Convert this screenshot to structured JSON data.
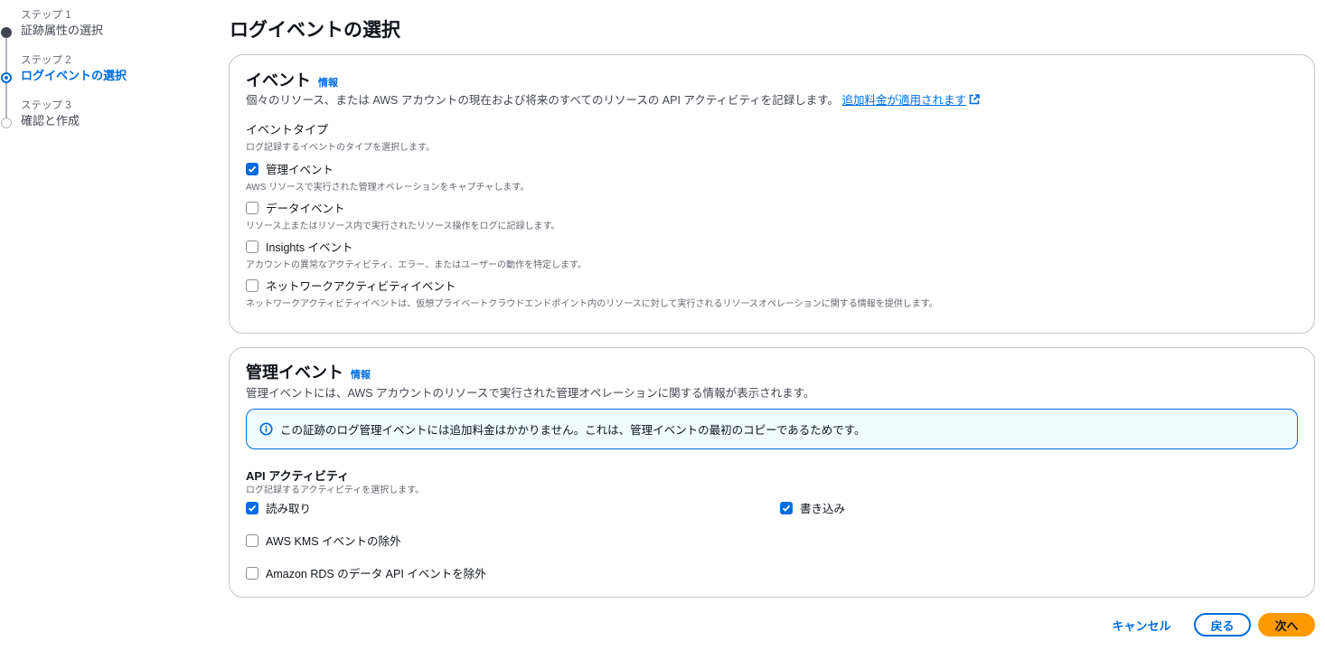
{
  "steps": [
    {
      "num": "ステップ 1",
      "title": "証跡属性の選択",
      "state": "done"
    },
    {
      "num": "ステップ 2",
      "title": "ログイベントの選択",
      "state": "active"
    },
    {
      "num": "ステップ 3",
      "title": "確認と作成",
      "state": "todo"
    }
  ],
  "page_title": "ログイベントの選択",
  "events_card": {
    "title": "イベント",
    "info": "情報",
    "description": "個々のリソース、または AWS アカウントの現在および将来のすべてのリソースの API アクティビティを記録します。",
    "link": "追加料金が適用されます",
    "event_type_label": "イベントタイプ",
    "event_type_hint": "ログ記録するイベントのタイプを選択します。",
    "options": [
      {
        "label": "管理イベント",
        "desc": "AWS リソースで実行された管理オペレーションをキャプチャします。",
        "checked": true
      },
      {
        "label": "データイベント",
        "desc": "リソース上またはリソース内で実行されたリソース操作をログに記録します。",
        "checked": false
      },
      {
        "label": "Insights イベント",
        "desc": "アカウントの異常なアクティビティ、エラー、またはユーザーの動作を特定します。",
        "checked": false
      },
      {
        "label": "ネットワークアクティビティイベント",
        "desc": "ネットワークアクティビティイベントは、仮想プライベートクラウドエンドポイント内のリソースに対して実行されるリソースオペレーションに関する情報を提供します。",
        "checked": false
      }
    ]
  },
  "mgmt_card": {
    "title": "管理イベント",
    "info": "情報",
    "description": "管理イベントには、AWS アカウントのリソースで実行された管理オペレーションに関する情報が表示されます。",
    "alert": "この証跡のログ管理イベントには追加料金はかかりません。これは、管理イベントの最初のコピーであるためです。",
    "api_label": "API アクティビティ",
    "api_hint": "ログ記録するアクティビティを選択します。",
    "read": {
      "label": "読み取り",
      "checked": true
    },
    "write": {
      "label": "書き込み",
      "checked": true
    },
    "exclude_kms": {
      "label": "AWS KMS イベントの除外",
      "checked": false
    },
    "exclude_rds": {
      "label": "Amazon RDS のデータ API イベントを除外",
      "checked": false
    }
  },
  "footer": {
    "cancel": "キャンセル",
    "back": "戻る",
    "next": "次へ"
  },
  "colors": {
    "accent": "#006ce0",
    "primary_button": "#ff9900",
    "alert_bg": "#f0fbff"
  }
}
